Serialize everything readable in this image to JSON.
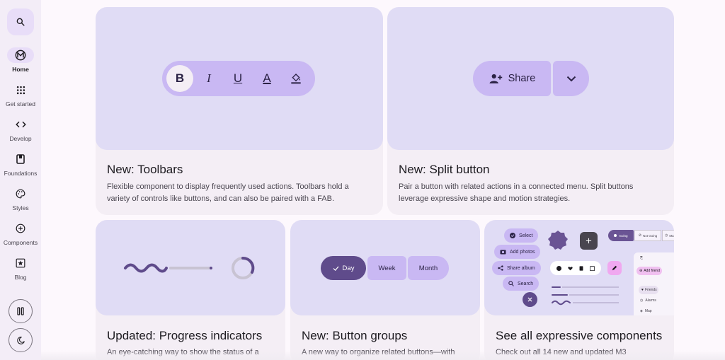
{
  "rail": {
    "search_icon": "search-icon",
    "items": [
      {
        "label": "Home",
        "icon": "material-logo-icon",
        "active": true
      },
      {
        "label": "Get started",
        "icon": "apps-grid-icon"
      },
      {
        "label": "Develop",
        "icon": "code-icon"
      },
      {
        "label": "Foundations",
        "icon": "book-icon"
      },
      {
        "label": "Styles",
        "icon": "palette-icon"
      },
      {
        "label": "Components",
        "icon": "add-circle-icon"
      },
      {
        "label": "Blog",
        "icon": "star-box-icon"
      }
    ],
    "pause_icon": "pause-icon",
    "theme_icon": "dark-mode-icon"
  },
  "cards": [
    {
      "title": "New: Toolbars",
      "description": "Flexible component to display frequently used actions. Toolbars hold a variety of controls like buttons, and can also be paired with a FAB.",
      "toolbar": {
        "bold": "B",
        "italic": "I",
        "underline": "U",
        "text_color": "A"
      }
    },
    {
      "title": "New: Split button",
      "description": "Pair a button with related actions in a connected menu. Split buttons leverage expressive shape and motion strategies.",
      "button_label": "Share"
    },
    {
      "title": "Updated: Progress indicators",
      "description": "An eye-catching way to show the status of a"
    },
    {
      "title": "New: Button groups",
      "description": "A new way to organize related buttons—with",
      "buttons": [
        "Day",
        "Week",
        "Month"
      ]
    },
    {
      "title": "See all expressive components",
      "description": "Check out all 14 new and updated M3",
      "chips": [
        "Select",
        "Add photos",
        "Share album",
        "Search"
      ],
      "segments": [
        "Going",
        "Not Going",
        "Ma"
      ],
      "list_items": [
        "Add friend",
        "Friends",
        "Alarms",
        "Map"
      ]
    }
  ],
  "colors": {
    "hero": "#e0dcf5",
    "accent": "#c9b8f3",
    "primary_dark": "#5f4b8b",
    "card": "#f4eef5"
  }
}
